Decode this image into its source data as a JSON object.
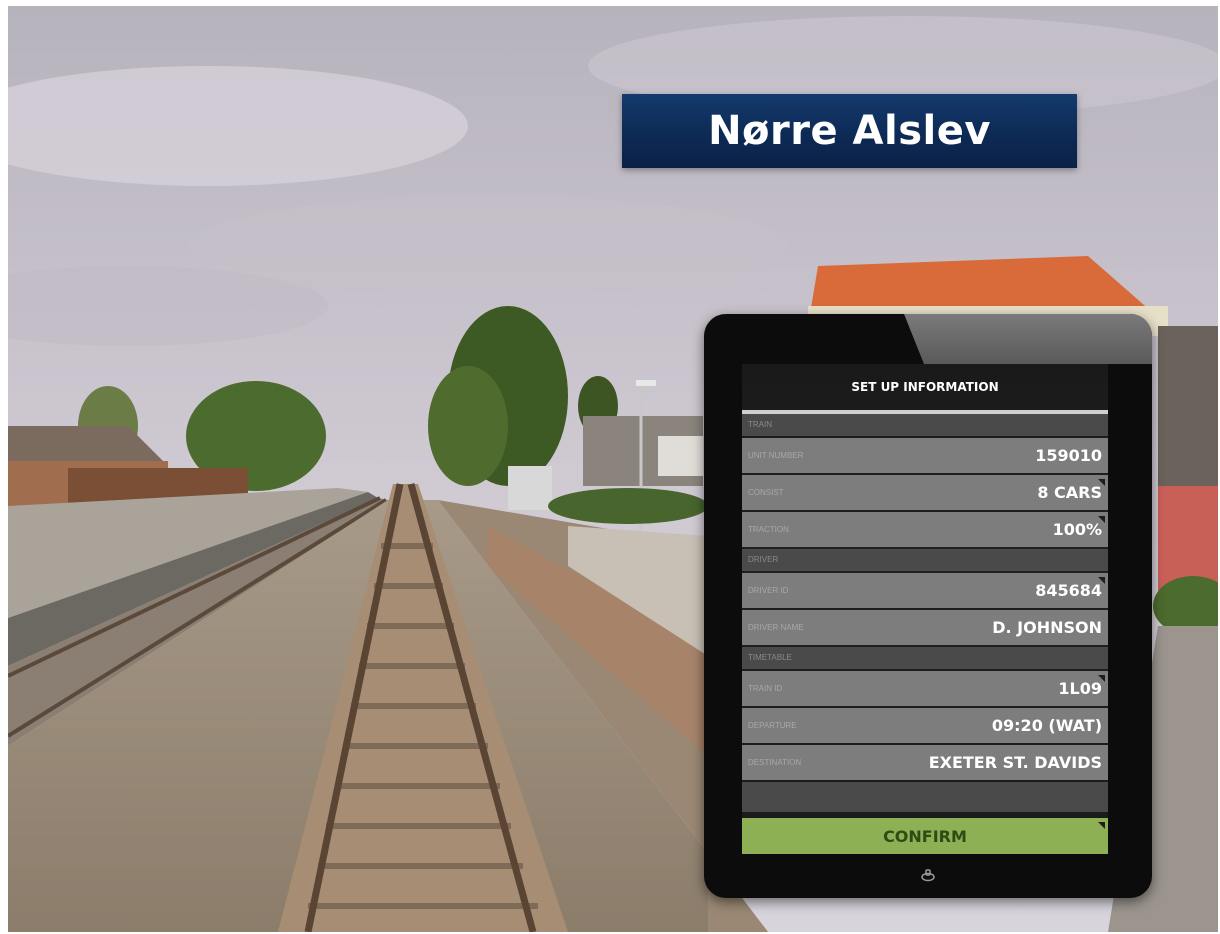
{
  "station_sign": {
    "name": "Nørre Alslev"
  },
  "tablet": {
    "title": "SET UP INFORMATION",
    "sections": [
      {
        "header": "TRAIN",
        "rows": [
          {
            "label": "UNIT NUMBER",
            "value": "159010",
            "selectable": false
          },
          {
            "label": "CONSIST",
            "value": "8 CARS",
            "selectable": true
          },
          {
            "label": "TRACTION",
            "value": "100%",
            "selectable": true
          }
        ]
      },
      {
        "header": "DRIVER",
        "rows": [
          {
            "label": "DRIVER ID",
            "value": "845684",
            "selectable": true
          },
          {
            "label": "DRIVER NAME",
            "value": "D. JOHNSON",
            "selectable": false
          }
        ]
      },
      {
        "header": "TIMETABLE",
        "rows": [
          {
            "label": "TRAIN ID",
            "value": "1L09",
            "selectable": true
          },
          {
            "label": "DEPARTURE",
            "value": "09:20 (WAT)",
            "selectable": false
          },
          {
            "label": "DESTINATION",
            "value": "EXETER ST. DAVIDS",
            "selectable": false
          }
        ]
      }
    ],
    "confirm_label": "CONFIRM"
  },
  "colors": {
    "sign_background": "#0d2a55",
    "row_background": "#7d7d7d",
    "section_header_background": "#4a4a4a",
    "confirm_background": "#8db054",
    "confirm_text": "#2f4a15"
  },
  "icons": {
    "home_button": "home-button-icon",
    "dropdown_corner": "dropdown-corner-icon"
  }
}
